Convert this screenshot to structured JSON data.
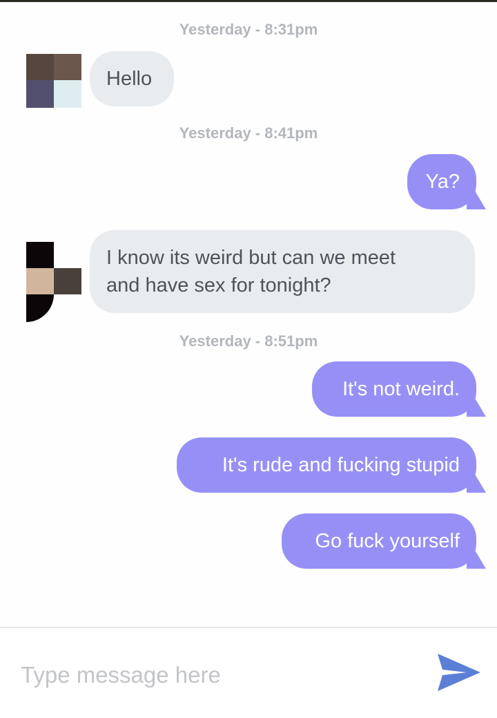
{
  "conversation": {
    "groups": [
      {
        "timestamp": "Yesterday - 8:31pm"
      },
      {
        "timestamp": "Yesterday - 8:41pm"
      },
      {
        "timestamp": "Yesterday - 8:51pm"
      }
    ],
    "messages": [
      {
        "direction": "incoming",
        "text": "Hello"
      },
      {
        "direction": "outgoing",
        "text": "Ya?"
      },
      {
        "direction": "incoming",
        "line1": "I know its weird but can we meet",
        "line2": "and have sex for tonight?"
      },
      {
        "direction": "outgoing",
        "text": "It's not weird."
      },
      {
        "direction": "outgoing",
        "text": "It's rude and fucking stupid"
      },
      {
        "direction": "outgoing",
        "text": "Go fuck yourself"
      }
    ]
  },
  "composer": {
    "placeholder": "Type message here",
    "value": "",
    "send_icon": "send-arrow-icon"
  },
  "colors": {
    "outgoing_bubble": "#9690f6",
    "incoming_bubble": "#e9ecef",
    "timestamp": "#b3b6bb",
    "send_icon": "#5b7fd6"
  }
}
